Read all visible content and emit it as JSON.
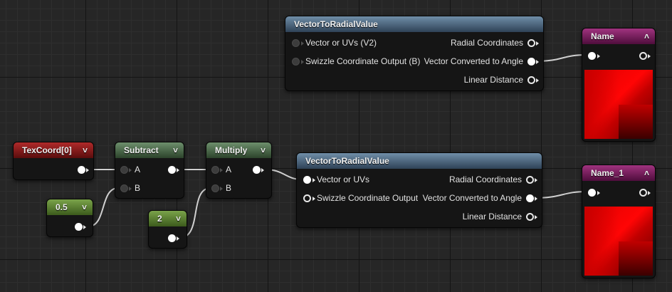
{
  "colors": {
    "wire": "#d0d0d0",
    "header_vector": "#4f6a83",
    "header_texcoord": "#8a1c1c",
    "header_math": "#4e6e4d",
    "header_constant": "#5a822e",
    "header_output": "#7c1f63"
  },
  "icons": {
    "collapse": "chevron-down-icon",
    "expand": "chevron-up-icon"
  },
  "nodes": {
    "vrv1": {
      "title": "VectorToRadialValue",
      "input_vector": "Vector or UVs (V2)",
      "input_swizzle": "Swizzle Coordinate Output (B)",
      "output_radial": "Radial Coordinates",
      "output_angle": "Vector Converted to Angle",
      "output_linear": "Linear Distance"
    },
    "vrv2": {
      "title": "VectorToRadialValue",
      "input_vector": "Vector or UVs",
      "input_swizzle": "Swizzle Coordinate Output",
      "output_radial": "Radial Coordinates",
      "output_angle": "Vector Converted to Angle",
      "output_linear": "Linear Distance"
    },
    "texcoord": {
      "title": "TexCoord[0]"
    },
    "subtract": {
      "title": "Subtract",
      "input_a": "A",
      "input_b": "B"
    },
    "multiply": {
      "title": "Multiply",
      "input_a": "A",
      "input_b": "B"
    },
    "const_half": {
      "title": "0.5"
    },
    "const_two": {
      "title": "2"
    },
    "output1": {
      "title": "Name"
    },
    "output2": {
      "title": "Name_1"
    }
  }
}
